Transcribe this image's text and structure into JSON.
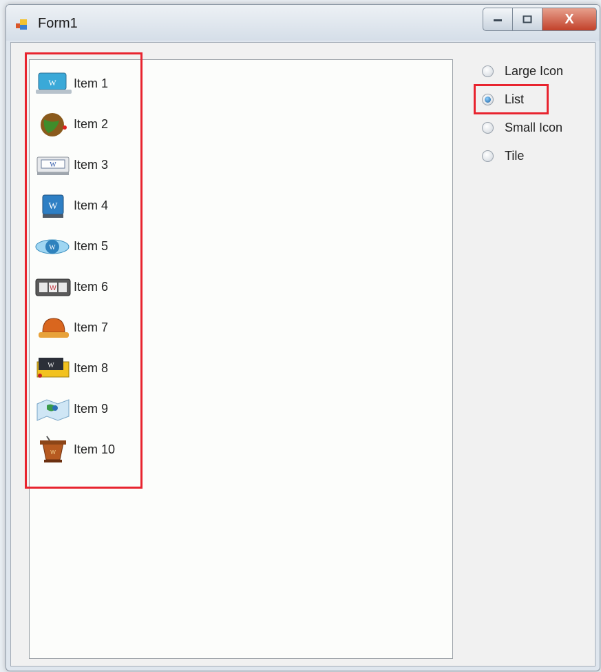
{
  "window": {
    "title": "Form1"
  },
  "caption": {
    "minimize_label": "",
    "maximize_label": "",
    "close_label": "X"
  },
  "listview": {
    "items": [
      {
        "label": "Item 1",
        "icon": "laptop-icon"
      },
      {
        "label": "Item 2",
        "icon": "globe-icon"
      },
      {
        "label": "Item 3",
        "icon": "scanner-icon"
      },
      {
        "label": "Item 4",
        "icon": "hard-drive-icon"
      },
      {
        "label": "Item 5",
        "icon": "wordpress-globe-icon"
      },
      {
        "label": "Item 6",
        "icon": "slot-machine-icon"
      },
      {
        "label": "Item 7",
        "icon": "hat-icon"
      },
      {
        "label": "Item 8",
        "icon": "notebook-icon"
      },
      {
        "label": "Item 9",
        "icon": "map-icon"
      },
      {
        "label": "Item 10",
        "icon": "podium-icon"
      }
    ]
  },
  "view_options": [
    {
      "label": "Large Icon",
      "checked": false
    },
    {
      "label": "List",
      "checked": true
    },
    {
      "label": "Small Icon",
      "checked": false
    },
    {
      "label": "Tile",
      "checked": false
    }
  ],
  "colors": {
    "highlight": "#e8242f"
  }
}
